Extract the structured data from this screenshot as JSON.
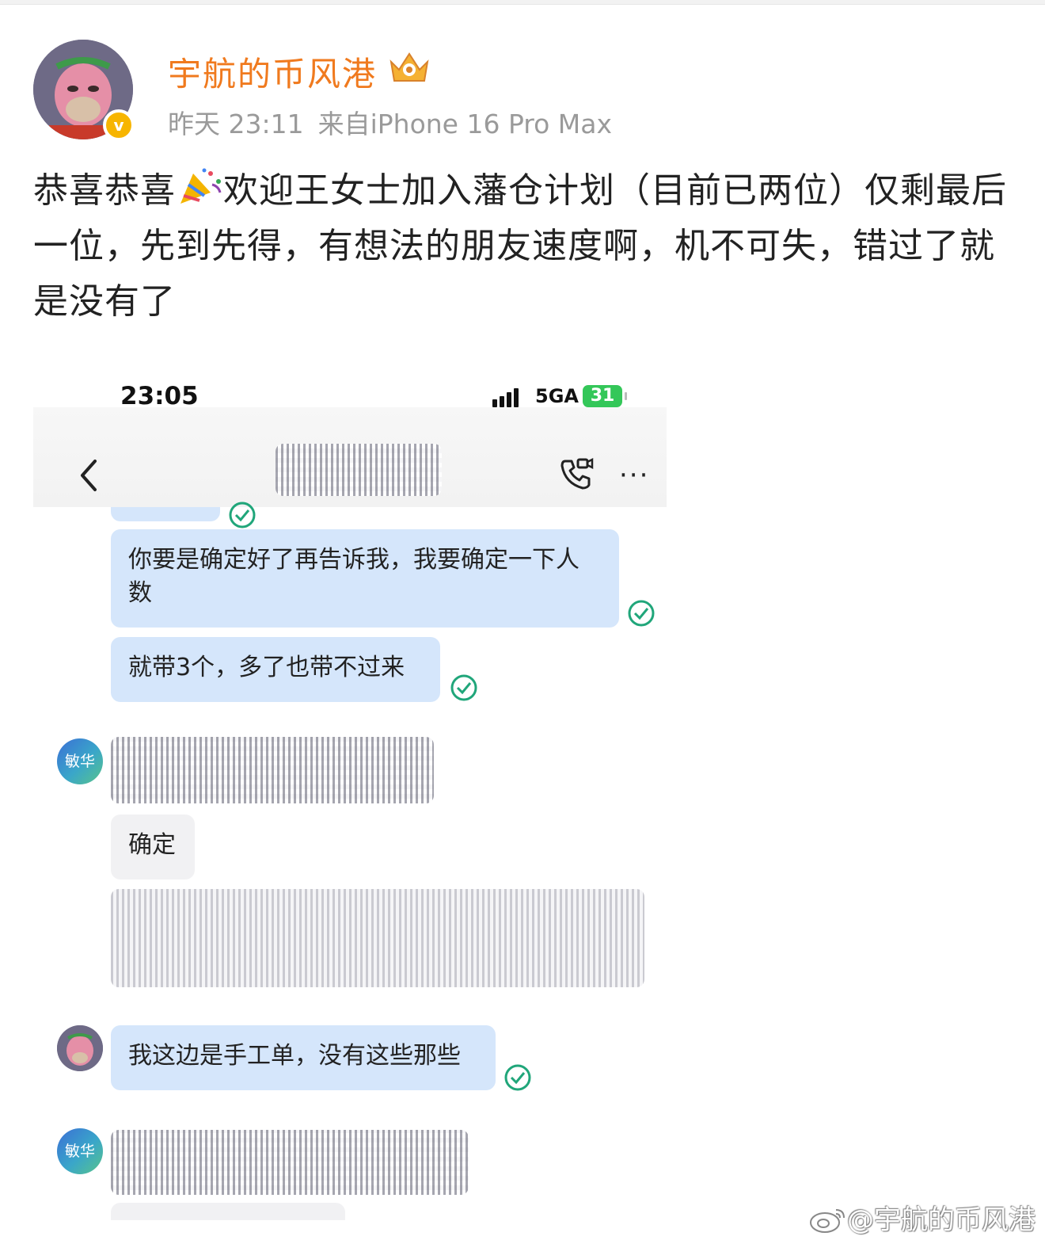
{
  "post": {
    "username": "宇航的币风港",
    "time": "昨天 23:11",
    "source": "来自iPhone 16 Pro Max",
    "text_before_emoji": "恭喜恭喜",
    "text_after_emoji": "欢迎王女士加入藩仓计划（目前已两位）仅剩最后一位，先到先得，有想法的朋友速度啊，机不可失，错过了就是没有了"
  },
  "screenshot": {
    "status_time": "23:05",
    "network": "5GA",
    "battery": "31",
    "messages": {
      "m1": "你要是确定好了再告诉我，我要确定一下人数",
      "m2": "就带3个，多了也带不过来",
      "contact_avatar_label": "敏华",
      "m3": "确定",
      "m4": "我这边是手工单，没有这些那些"
    }
  },
  "watermark": "@宇航的币风港",
  "icons": [
    "verified-badge-icon",
    "crown-badge-icon",
    "party-popper-icon",
    "back-icon",
    "video-call-icon",
    "more-icon",
    "read-check-icon",
    "weibo-logo-icon"
  ],
  "colors": {
    "username": "#f07a1e",
    "meta": "#9a9a9a",
    "my_bubble": "#d5e6fb",
    "their_bubble": "#f1f1f3",
    "check": "#20a67a",
    "verified": "#f7b500"
  }
}
